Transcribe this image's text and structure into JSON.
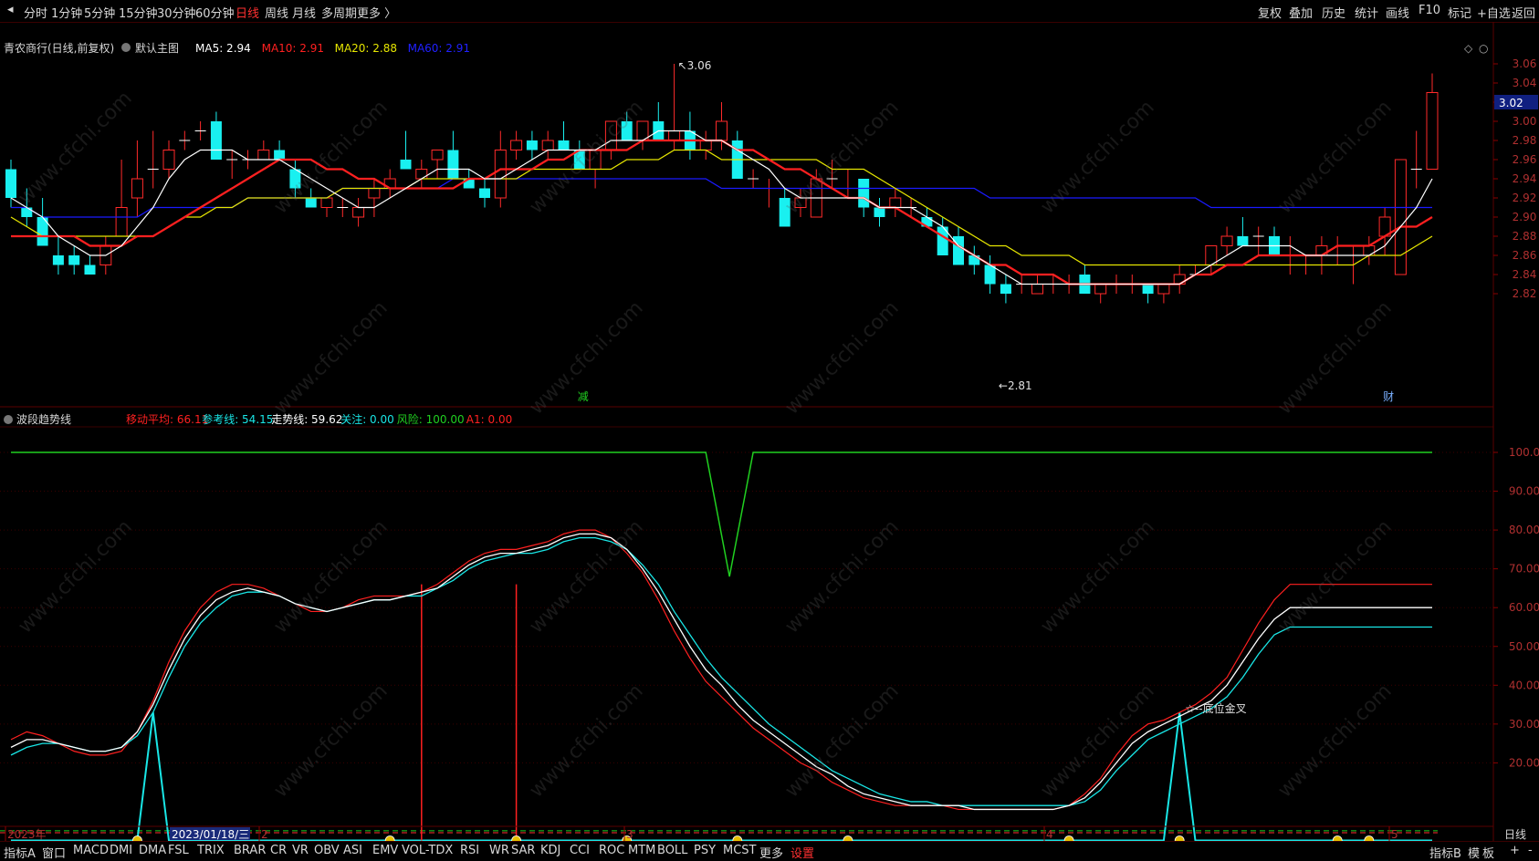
{
  "period_tabs": [
    "分时",
    "1分钟",
    "5分钟",
    "15分钟",
    "30分钟",
    "60分钟",
    "日线",
    "周线",
    "月线",
    "多周期",
    "更多 〉"
  ],
  "active_period": "日线",
  "right_tools": [
    "复权",
    "叠加",
    "历史",
    "统计",
    "画线",
    "F10",
    "标记",
    "+自选",
    "返回"
  ],
  "main_header": {
    "stock": "青农商行(日线,前复权)",
    "template": "默认主图",
    "ma": [
      {
        "label": "MA5: 2.94",
        "color": "#ffffff"
      },
      {
        "label": "MA10: 2.91",
        "color": "#ff2020"
      },
      {
        "label": "MA20: 2.88",
        "color": "#e6e600"
      },
      {
        "label": "MA60: 2.91",
        "color": "#2020ff"
      }
    ]
  },
  "price_axis": [
    "3.06",
    "3.04",
    "3.02",
    "3.00",
    "2.98",
    "2.96",
    "2.94",
    "2.92",
    "2.90",
    "2.88",
    "2.86",
    "2.84",
    "2.82"
  ],
  "current_price": "3.02",
  "high_label": "3.06",
  "low_label": "2.81",
  "markers": [
    "减",
    "财"
  ],
  "sub_header": {
    "name": "波段趋势线",
    "items": [
      {
        "label": "移动平均: 66.11",
        "color": "#ff2020"
      },
      {
        "label": "参考线: 54.15",
        "color": "#19e6e6"
      },
      {
        "label": "走势线: 59.62",
        "color": "#ffffff"
      },
      {
        "label": "关注: 0.00",
        "color": "#19e6e6"
      },
      {
        "label": "风险: 100.00",
        "color": "#20d020"
      },
      {
        "label": "A1: 0.00",
        "color": "#ff2020"
      }
    ]
  },
  "sub_axis": [
    "100.0",
    "90.00",
    "80.00",
    "70.00",
    "60.00",
    "50.00",
    "40.00",
    "30.00",
    "20.00"
  ],
  "golden_cross_label": "☆--底位金叉",
  "date_labels": [
    "2023年",
    "2",
    "3",
    "4",
    "5"
  ],
  "cursor_date": "2023/01/18/三",
  "axis_period": "日线",
  "indicator_tabs": [
    "指标A",
    "窗口",
    "MACD",
    "DMI",
    "DMA",
    "FSL",
    "TRIX",
    "BRAR",
    "CR",
    "VR",
    "OBV",
    "ASI",
    "EMV",
    "VOL-TDX",
    "RSI",
    "WR",
    "SAR",
    "KDJ",
    "CCI",
    "ROC",
    "MTM",
    "BOLL",
    "PSY",
    "MCST",
    "更多",
    "设置"
  ],
  "bottom_right": [
    "指标B",
    "模",
    "板",
    "+",
    "-"
  ],
  "watermark": "www.cfchi.com",
  "colors": {
    "up": "#ff2a2a",
    "down": "#19f0f0",
    "ma5": "#ffffff",
    "ma10": "#ff2020",
    "ma20": "#e6e600",
    "ma60": "#1a1aff",
    "grid": "#5a0000"
  },
  "chart_data": {
    "type": "candlestick",
    "ohlc": [
      [
        2.95,
        2.96,
        2.91,
        2.92
      ],
      [
        2.91,
        2.93,
        2.89,
        2.9
      ],
      [
        2.9,
        2.92,
        2.87,
        2.87
      ],
      [
        2.86,
        2.88,
        2.84,
        2.85
      ],
      [
        2.86,
        2.87,
        2.84,
        2.85
      ],
      [
        2.85,
        2.86,
        2.84,
        2.84
      ],
      [
        2.85,
        2.88,
        2.84,
        2.87
      ],
      [
        2.88,
        2.96,
        2.88,
        2.91
      ],
      [
        2.92,
        2.98,
        2.9,
        2.94
      ],
      [
        2.95,
        2.99,
        2.93,
        2.95
      ],
      [
        2.95,
        2.98,
        2.94,
        2.97
      ],
      [
        2.98,
        2.99,
        2.97,
        2.98
      ],
      [
        2.99,
        3.0,
        2.98,
        2.99
      ],
      [
        3.0,
        3.01,
        2.96,
        2.96
      ],
      [
        2.96,
        2.97,
        2.94,
        2.96
      ],
      [
        2.96,
        2.97,
        2.95,
        2.96
      ],
      [
        2.96,
        2.98,
        2.96,
        2.97
      ],
      [
        2.97,
        2.98,
        2.96,
        2.96
      ],
      [
        2.95,
        2.96,
        2.92,
        2.93
      ],
      [
        2.92,
        2.93,
        2.91,
        2.91
      ],
      [
        2.91,
        2.92,
        2.9,
        2.92
      ],
      [
        2.91,
        2.92,
        2.9,
        2.91
      ],
      [
        2.9,
        2.92,
        2.89,
        2.91
      ],
      [
        2.92,
        2.94,
        2.9,
        2.93
      ],
      [
        2.93,
        2.95,
        2.92,
        2.94
      ],
      [
        2.96,
        2.99,
        2.95,
        2.95
      ],
      [
        2.94,
        2.96,
        2.93,
        2.95
      ],
      [
        2.96,
        2.97,
        2.94,
        2.97
      ],
      [
        2.97,
        2.99,
        2.96,
        2.94
      ],
      [
        2.94,
        2.95,
        2.93,
        2.93
      ],
      [
        2.93,
        2.94,
        2.91,
        2.92
      ],
      [
        2.92,
        2.99,
        2.91,
        2.97
      ],
      [
        2.97,
        2.99,
        2.96,
        2.98
      ],
      [
        2.98,
        2.99,
        2.96,
        2.97
      ],
      [
        2.97,
        2.99,
        2.96,
        2.98
      ],
      [
        2.98,
        3.0,
        2.97,
        2.97
      ],
      [
        2.97,
        2.98,
        2.95,
        2.95
      ],
      [
        2.95,
        2.97,
        2.93,
        2.97
      ],
      [
        2.97,
        3.0,
        2.96,
        3.0
      ],
      [
        3.0,
        3.01,
        2.99,
        2.98
      ],
      [
        2.98,
        3.0,
        2.97,
        3.0
      ],
      [
        3.0,
        3.02,
        2.98,
        2.98
      ],
      [
        2.98,
        3.06,
        2.97,
        2.99
      ],
      [
        2.99,
        3.01,
        2.96,
        2.97
      ],
      [
        2.97,
        2.99,
        2.96,
        2.98
      ],
      [
        2.98,
        3.02,
        2.97,
        3.0
      ],
      [
        2.98,
        2.99,
        2.94,
        2.94
      ],
      [
        2.94,
        2.95,
        2.93,
        2.94
      ],
      [
        2.93,
        2.94,
        2.91,
        2.93
      ],
      [
        2.92,
        2.93,
        2.89,
        2.89
      ],
      [
        2.91,
        2.93,
        2.9,
        2.92
      ],
      [
        2.9,
        2.95,
        2.9,
        2.94
      ],
      [
        2.94,
        2.96,
        2.93,
        2.94
      ],
      [
        2.93,
        2.95,
        2.92,
        2.93
      ],
      [
        2.94,
        2.94,
        2.9,
        2.91
      ],
      [
        2.91,
        2.92,
        2.89,
        2.9
      ],
      [
        2.91,
        2.93,
        2.9,
        2.92
      ],
      [
        2.91,
        2.92,
        2.9,
        2.91
      ],
      [
        2.9,
        2.91,
        2.89,
        2.89
      ],
      [
        2.89,
        2.9,
        2.86,
        2.86
      ],
      [
        2.88,
        2.89,
        2.85,
        2.85
      ],
      [
        2.86,
        2.87,
        2.84,
        2.85
      ],
      [
        2.85,
        2.86,
        2.82,
        2.83
      ],
      [
        2.83,
        2.84,
        2.81,
        2.82
      ],
      [
        2.83,
        2.84,
        2.82,
        2.83
      ],
      [
        2.82,
        2.84,
        2.82,
        2.83
      ],
      [
        2.83,
        2.84,
        2.82,
        2.83
      ],
      [
        2.83,
        2.84,
        2.82,
        2.83
      ],
      [
        2.84,
        2.85,
        2.82,
        2.82
      ],
      [
        2.82,
        2.83,
        2.81,
        2.83
      ],
      [
        2.83,
        2.84,
        2.82,
        2.83
      ],
      [
        2.83,
        2.84,
        2.82,
        2.83
      ],
      [
        2.83,
        2.83,
        2.81,
        2.82
      ],
      [
        2.82,
        2.83,
        2.81,
        2.83
      ],
      [
        2.83,
        2.85,
        2.82,
        2.84
      ],
      [
        2.84,
        2.85,
        2.84,
        2.84
      ],
      [
        2.85,
        2.87,
        2.84,
        2.87
      ],
      [
        2.87,
        2.89,
        2.86,
        2.88
      ],
      [
        2.88,
        2.9,
        2.87,
        2.87
      ],
      [
        2.88,
        2.89,
        2.86,
        2.88
      ],
      [
        2.88,
        2.89,
        2.86,
        2.86
      ],
      [
        2.86,
        2.88,
        2.84,
        2.86
      ],
      [
        2.85,
        2.86,
        2.84,
        2.85
      ],
      [
        2.86,
        2.88,
        2.84,
        2.87
      ],
      [
        2.86,
        2.88,
        2.85,
        2.86
      ],
      [
        2.86,
        2.87,
        2.83,
        2.86
      ],
      [
        2.86,
        2.88,
        2.85,
        2.87
      ],
      [
        2.88,
        2.91,
        2.86,
        2.9
      ],
      [
        2.84,
        2.96,
        2.84,
        2.96
      ],
      [
        2.95,
        2.99,
        2.93,
        2.95
      ],
      [
        2.95,
        3.05,
        2.95,
        3.03
      ]
    ],
    "ma5": [
      2.92,
      2.91,
      2.9,
      2.88,
      2.87,
      2.86,
      2.86,
      2.87,
      2.89,
      2.91,
      2.94,
      2.96,
      2.97,
      2.97,
      2.97,
      2.96,
      2.96,
      2.96,
      2.95,
      2.94,
      2.93,
      2.92,
      2.91,
      2.91,
      2.92,
      2.93,
      2.94,
      2.95,
      2.95,
      2.95,
      2.94,
      2.94,
      2.95,
      2.96,
      2.97,
      2.97,
      2.97,
      2.97,
      2.98,
      2.98,
      2.98,
      2.99,
      2.99,
      2.99,
      2.98,
      2.98,
      2.97,
      2.96,
      2.95,
      2.93,
      2.92,
      2.92,
      2.92,
      2.92,
      2.92,
      2.91,
      2.91,
      2.91,
      2.9,
      2.89,
      2.87,
      2.86,
      2.85,
      2.84,
      2.83,
      2.83,
      2.83,
      2.83,
      2.83,
      2.83,
      2.83,
      2.83,
      2.83,
      2.83,
      2.83,
      2.84,
      2.85,
      2.86,
      2.87,
      2.87,
      2.87,
      2.87,
      2.86,
      2.86,
      2.86,
      2.86,
      2.86,
      2.87,
      2.89,
      2.91,
      2.94
    ],
    "ma10": [
      2.88,
      2.88,
      2.88,
      2.88,
      2.88,
      2.87,
      2.87,
      2.87,
      2.88,
      2.88,
      2.89,
      2.9,
      2.91,
      2.92,
      2.93,
      2.94,
      2.95,
      2.96,
      2.96,
      2.96,
      2.95,
      2.95,
      2.94,
      2.94,
      2.93,
      2.93,
      2.93,
      2.93,
      2.93,
      2.94,
      2.94,
      2.95,
      2.95,
      2.95,
      2.96,
      2.96,
      2.97,
      2.97,
      2.97,
      2.97,
      2.98,
      2.98,
      2.98,
      2.98,
      2.98,
      2.98,
      2.97,
      2.97,
      2.96,
      2.95,
      2.95,
      2.94,
      2.93,
      2.92,
      2.92,
      2.91,
      2.91,
      2.9,
      2.89,
      2.88,
      2.87,
      2.86,
      2.85,
      2.85,
      2.84,
      2.84,
      2.84,
      2.83,
      2.83,
      2.83,
      2.83,
      2.83,
      2.83,
      2.83,
      2.83,
      2.84,
      2.84,
      2.85,
      2.85,
      2.86,
      2.86,
      2.86,
      2.86,
      2.86,
      2.87,
      2.87,
      2.87,
      2.88,
      2.89,
      2.89,
      2.9
    ],
    "ma20": [
      2.9,
      2.89,
      2.88,
      2.88,
      2.88,
      2.88,
      2.88,
      2.88,
      2.88,
      2.88,
      2.89,
      2.9,
      2.9,
      2.91,
      2.91,
      2.92,
      2.92,
      2.92,
      2.92,
      2.92,
      2.92,
      2.93,
      2.93,
      2.93,
      2.93,
      2.93,
      2.94,
      2.94,
      2.94,
      2.94,
      2.94,
      2.94,
      2.94,
      2.95,
      2.95,
      2.95,
      2.95,
      2.95,
      2.95,
      2.96,
      2.96,
      2.96,
      2.97,
      2.97,
      2.97,
      2.96,
      2.96,
      2.96,
      2.96,
      2.96,
      2.96,
      2.96,
      2.95,
      2.95,
      2.95,
      2.94,
      2.93,
      2.92,
      2.91,
      2.9,
      2.89,
      2.88,
      2.87,
      2.87,
      2.86,
      2.86,
      2.86,
      2.86,
      2.85,
      2.85,
      2.85,
      2.85,
      2.85,
      2.85,
      2.85,
      2.85,
      2.85,
      2.85,
      2.85,
      2.85,
      2.85,
      2.85,
      2.85,
      2.85,
      2.85,
      2.85,
      2.86,
      2.86,
      2.86,
      2.87,
      2.88
    ],
    "ma60": [
      2.91,
      2.91,
      2.9,
      2.9,
      2.9,
      2.9,
      2.9,
      2.9,
      2.9,
      2.91,
      2.91,
      2.91,
      2.91,
      2.91,
      2.91,
      2.92,
      2.92,
      2.92,
      2.92,
      2.92,
      2.92,
      2.93,
      2.93,
      2.93,
      2.93,
      2.93,
      2.93,
      2.93,
      2.94,
      2.94,
      2.94,
      2.94,
      2.94,
      2.94,
      2.94,
      2.94,
      2.94,
      2.94,
      2.94,
      2.94,
      2.94,
      2.94,
      2.94,
      2.94,
      2.94,
      2.93,
      2.93,
      2.93,
      2.93,
      2.93,
      2.93,
      2.93,
      2.93,
      2.93,
      2.93,
      2.93,
      2.93,
      2.93,
      2.93,
      2.93,
      2.93,
      2.93,
      2.92,
      2.92,
      2.92,
      2.92,
      2.92,
      2.92,
      2.92,
      2.92,
      2.92,
      2.92,
      2.92,
      2.92,
      2.92,
      2.92,
      2.91,
      2.91,
      2.91,
      2.91,
      2.91,
      2.91,
      2.91,
      2.91,
      2.91,
      2.91,
      2.91,
      2.91,
      2.91,
      2.91,
      2.91
    ],
    "wave_move_avg": [
      26,
      28,
      27,
      25,
      23,
      22,
      22,
      23,
      28,
      36,
      46,
      54,
      60,
      64,
      66,
      66,
      65,
      63,
      61,
      59,
      59,
      60,
      62,
      63,
      63,
      63,
      64,
      66,
      69,
      72,
      74,
      75,
      75,
      76,
      77,
      79,
      80,
      80,
      78,
      74,
      69,
      62,
      54,
      47,
      41,
      37,
      33,
      29,
      26,
      23,
      20,
      18,
      15,
      13,
      11,
      10,
      9,
      9,
      9,
      9,
      8,
      8,
      8,
      8,
      8,
      8,
      8,
      9,
      12,
      16,
      22,
      27,
      30,
      31,
      33,
      35,
      38,
      42,
      49,
      56,
      62,
      66,
      66,
      66,
      66,
      66,
      66,
      66,
      66,
      66,
      66
    ],
    "wave_trend": [
      24,
      26,
      26,
      25,
      24,
      23,
      23,
      24,
      28,
      35,
      44,
      52,
      58,
      62,
      64,
      65,
      64,
      63,
      61,
      60,
      59,
      60,
      61,
      62,
      62,
      63,
      64,
      65,
      68,
      71,
      73,
      74,
      74,
      75,
      76,
      78,
      79,
      79,
      78,
      75,
      70,
      64,
      57,
      50,
      44,
      40,
      35,
      31,
      28,
      25,
      22,
      19,
      17,
      14,
      12,
      11,
      10,
      9,
      9,
      9,
      9,
      8,
      8,
      8,
      8,
      8,
      8,
      9,
      11,
      15,
      20,
      25,
      28,
      30,
      32,
      34,
      36,
      40,
      46,
      52,
      57,
      60,
      60,
      60,
      60,
      60,
      60,
      60,
      60,
      60,
      60
    ],
    "wave_ref": [
      22,
      24,
      25,
      25,
      24,
      23,
      23,
      24,
      27,
      33,
      42,
      50,
      56,
      60,
      63,
      64,
      64,
      63,
      61,
      60,
      59,
      60,
      61,
      62,
      62,
      63,
      63,
      65,
      67,
      70,
      72,
      73,
      74,
      74,
      75,
      77,
      78,
      78,
      77,
      75,
      71,
      66,
      59,
      53,
      47,
      42,
      38,
      34,
      30,
      27,
      24,
      21,
      18,
      16,
      14,
      12,
      11,
      10,
      10,
      9,
      9,
      9,
      9,
      9,
      9,
      9,
      9,
      9,
      10,
      13,
      18,
      22,
      26,
      28,
      30,
      32,
      34,
      37,
      42,
      48,
      53,
      55,
      55,
      55,
      55,
      55,
      55,
      55,
      55,
      55,
      55
    ],
    "risk_line": "100 except dip to 68 near day 45",
    "cyan_spike_days": [
      9,
      74
    ],
    "red_signal_days": [
      26,
      32
    ]
  }
}
